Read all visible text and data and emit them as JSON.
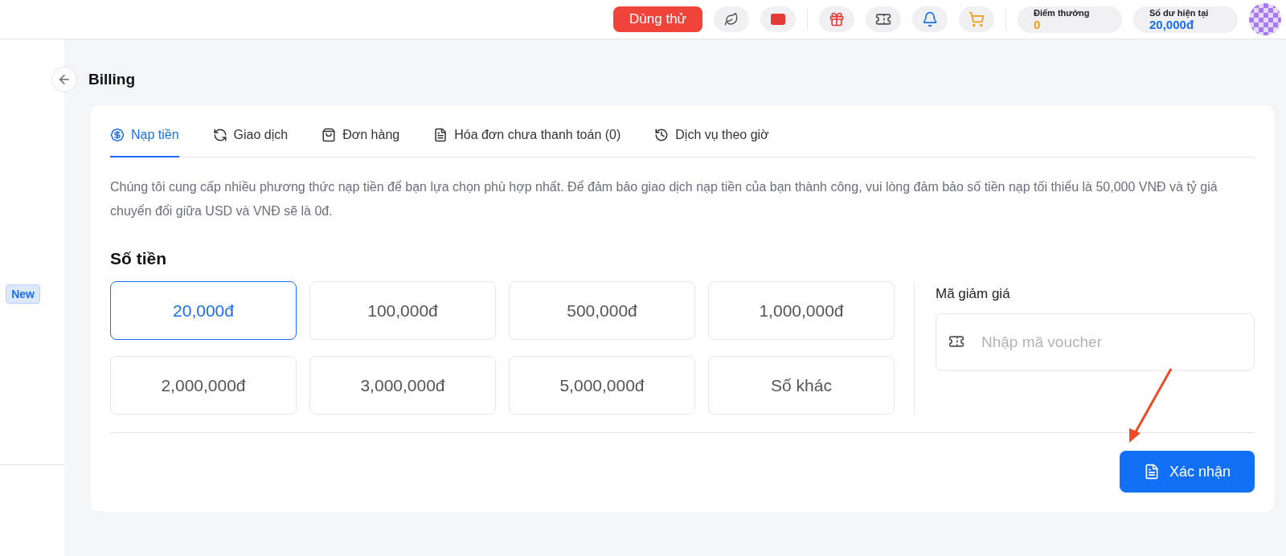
{
  "header": {
    "trial_button": "Dùng thử",
    "points": {
      "label": "Điểm thưởng",
      "value": "0"
    },
    "balance": {
      "label": "Số dư hiện tại",
      "value": "20,000đ"
    }
  },
  "sidebar": {
    "badge": "New"
  },
  "page": {
    "title": "Billing"
  },
  "tabs": [
    {
      "label": "Nạp tiền",
      "selected": true
    },
    {
      "label": "Giao dịch",
      "selected": false
    },
    {
      "label": "Đơn hàng",
      "selected": false
    },
    {
      "label": "Hóa đơn chưa thanh toán (0)",
      "selected": false
    },
    {
      "label": "Dịch vụ theo giờ",
      "selected": false
    }
  ],
  "description": "Chúng tôi cung cấp nhiều phương thức nạp tiền để bạn lựa chọn phù hợp nhất. Để đảm bảo giao dịch nạp tiền của bạn thành công, vui lòng đảm bảo số tiền nạp tối thiểu là 50,000 VNĐ và tỷ giá chuyển đổi giữa USD và VNĐ sẽ là 0đ.",
  "amount": {
    "title": "Số tiền",
    "options": [
      {
        "label": "20,000đ",
        "selected": true
      },
      {
        "label": "100,000đ",
        "selected": false
      },
      {
        "label": "500,000đ",
        "selected": false
      },
      {
        "label": "1,000,000đ",
        "selected": false
      },
      {
        "label": "2,000,000đ",
        "selected": false
      },
      {
        "label": "3,000,000đ",
        "selected": false
      },
      {
        "label": "5,000,000đ",
        "selected": false
      },
      {
        "label": "Số khác",
        "selected": false
      }
    ]
  },
  "voucher": {
    "label": "Mã giảm giá",
    "placeholder": "Nhập mã voucher"
  },
  "confirm_button": "Xác nhận"
}
